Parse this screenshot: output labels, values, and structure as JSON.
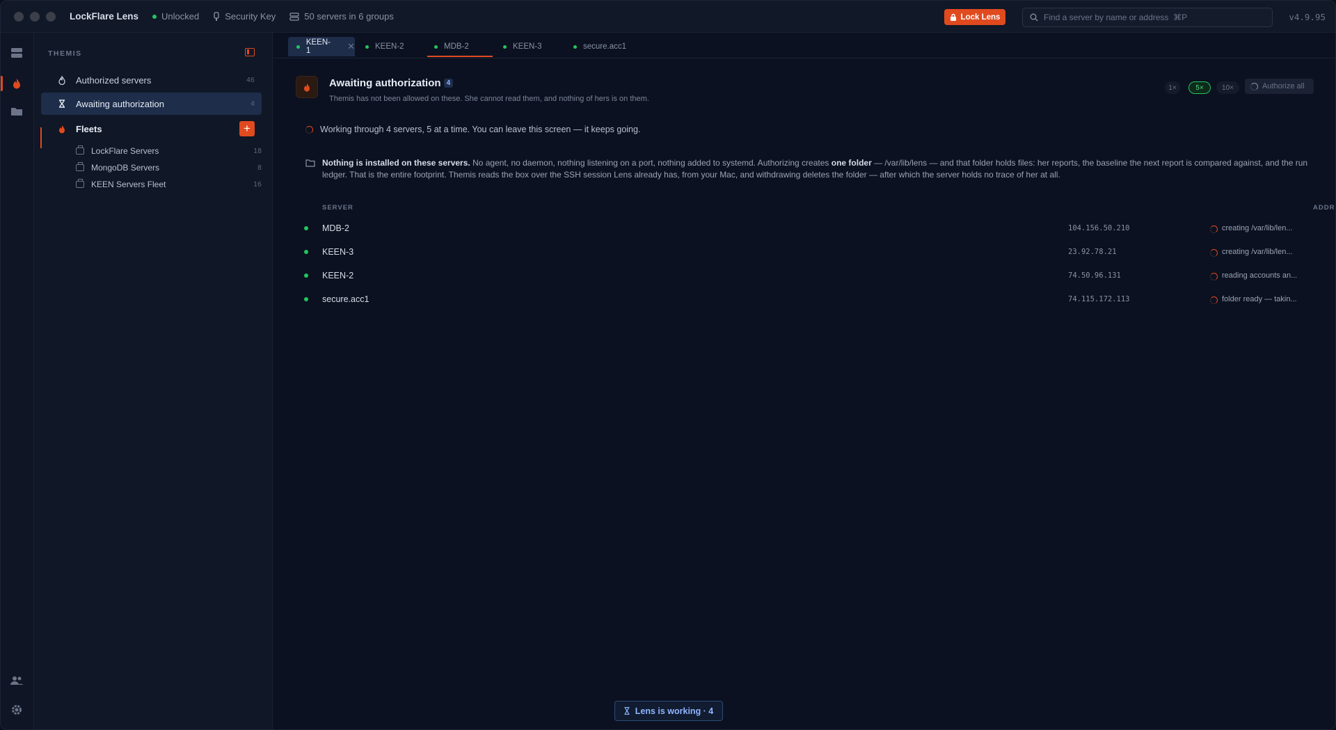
{
  "app": {
    "title": "LockFlare Lens",
    "lock_state": "Unlocked",
    "auth_method": "Security Key",
    "servers_summary": "50 servers in 6 groups",
    "lock_button": "Lock Lens",
    "search_placeholder": "Find a server by name or address  ⌘P",
    "version": "v4.9.95"
  },
  "colors": {
    "accent": "#e04a1f",
    "online": "#22c55e",
    "selected": "#1e2d4a"
  },
  "sidebar": {
    "heading": "THEMIS",
    "items": [
      {
        "label": "Authorized servers",
        "count": "46",
        "icon": "flame-icon"
      },
      {
        "label": "Awaiting authorization",
        "count": "4",
        "icon": "hourglass-icon",
        "active": true
      }
    ],
    "fleets": {
      "label": "Fleets",
      "add_label": "+",
      "items": [
        {
          "label": "LockFlare Servers",
          "count": "18"
        },
        {
          "label": "MongoDB Servers",
          "count": "8"
        },
        {
          "label": "KEEN Servers Fleet",
          "count": "16"
        }
      ]
    }
  },
  "tabs": [
    {
      "label": "KEEN-1",
      "active": true,
      "close": "✕"
    },
    {
      "label": "KEEN-2"
    },
    {
      "label": "MDB-2",
      "underlined": true
    },
    {
      "label": "KEEN-3"
    },
    {
      "label": "secure.acc1"
    }
  ],
  "page": {
    "title": "Awaiting authorization",
    "badge": "4",
    "subtitle": "Themis has not been allowed on these. She cannot read them, and nothing of hers is on them.",
    "concurrency": [
      "1×",
      "5×",
      "10×"
    ],
    "concurrency_selected": "5×",
    "authorize_all": "Authorize all",
    "working_text": "Working through 4 servers, 5 at a time. You can leave this screen — it keeps going.",
    "notice": {
      "lead": "Nothing is installed on these servers.",
      "part1": " No agent, no daemon, nothing listening on a port, nothing added to systemd. Authorizing creates ",
      "bold2": "one folder",
      "part2": " — /var/lib/lens — and that folder holds files: her reports, the baseline the next report is compared against, and the run ledger. That is the entire footprint. Themis reads the box over the SSH session Lens already has, from your Mac, and withdrawing deletes the folder — after which the server holds no trace of her at all."
    },
    "columns": {
      "server": "SERVER",
      "address": "ADDRESS"
    },
    "servers": [
      {
        "name": "MDB-2",
        "address": "104.156.50.210",
        "status": "creating /var/lib/len..."
      },
      {
        "name": "KEEN-3",
        "address": "23.92.78.21",
        "status": "creating /var/lib/len..."
      },
      {
        "name": "KEEN-2",
        "address": "74.50.96.131",
        "status": "reading accounts an..."
      },
      {
        "name": "secure.acc1",
        "address": "74.115.172.113",
        "status": "folder ready — takin..."
      }
    ],
    "working_pill": "Lens is working · 4"
  }
}
